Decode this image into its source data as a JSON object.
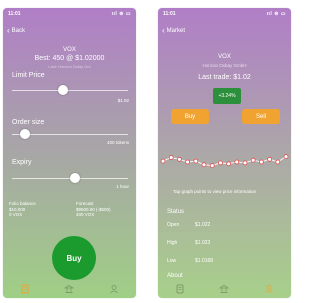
{
  "left": {
    "status": {
      "time": "11:01",
      "indicators": "ııl ⊜ ▭"
    },
    "nav": {
      "back_label": "Back"
    },
    "title": "VOX",
    "best": "Best: 450 @ $1.02000",
    "subtitle": "Last: Horizon Dolay Gm",
    "limit_price": {
      "label": "Limit Price",
      "value": "$1.02",
      "fraction": 0.43
    },
    "order_size": {
      "label": "Order size",
      "value": "400 tokens",
      "fraction": 0.08
    },
    "expiry": {
      "label": "Expiry",
      "value": "1 hour",
      "fraction": 0.55
    },
    "portfolio": {
      "title": "Folio balance",
      "cash": "$10,000",
      "tokens": "0 VOX"
    },
    "forecast": {
      "title": "Forecast",
      "cash": "$9500.00 (-$500)",
      "tokens": "400 VOX"
    },
    "buy_label": "Buy",
    "tabs": [
      "tab-trade",
      "tab-bank",
      "tab-profile"
    ]
  },
  "right": {
    "status": {
      "time": "11:01",
      "indicators": "ııl ⊜ ▭"
    },
    "nav": {
      "back_label": "Market"
    },
    "name": "VOX",
    "org": "Horizon Oxbay GmbH",
    "last_trade": "Last trade: $1.02",
    "change": "+3.24%",
    "buy_label": "Buy",
    "sell_label": "Sell",
    "hint": "Tap graph points to view price information",
    "status_title": "Status",
    "stats": [
      {
        "key": "Open",
        "value": "$1.022"
      },
      {
        "key": "High",
        "value": "$1.023"
      },
      {
        "key": "Low",
        "value": "$1.0168"
      }
    ],
    "about": "About",
    "accent_colors": {
      "orange": "#f0a331",
      "green": "#2c8f3b",
      "points": "#ffffff",
      "point_border": "#e54646"
    }
  }
}
